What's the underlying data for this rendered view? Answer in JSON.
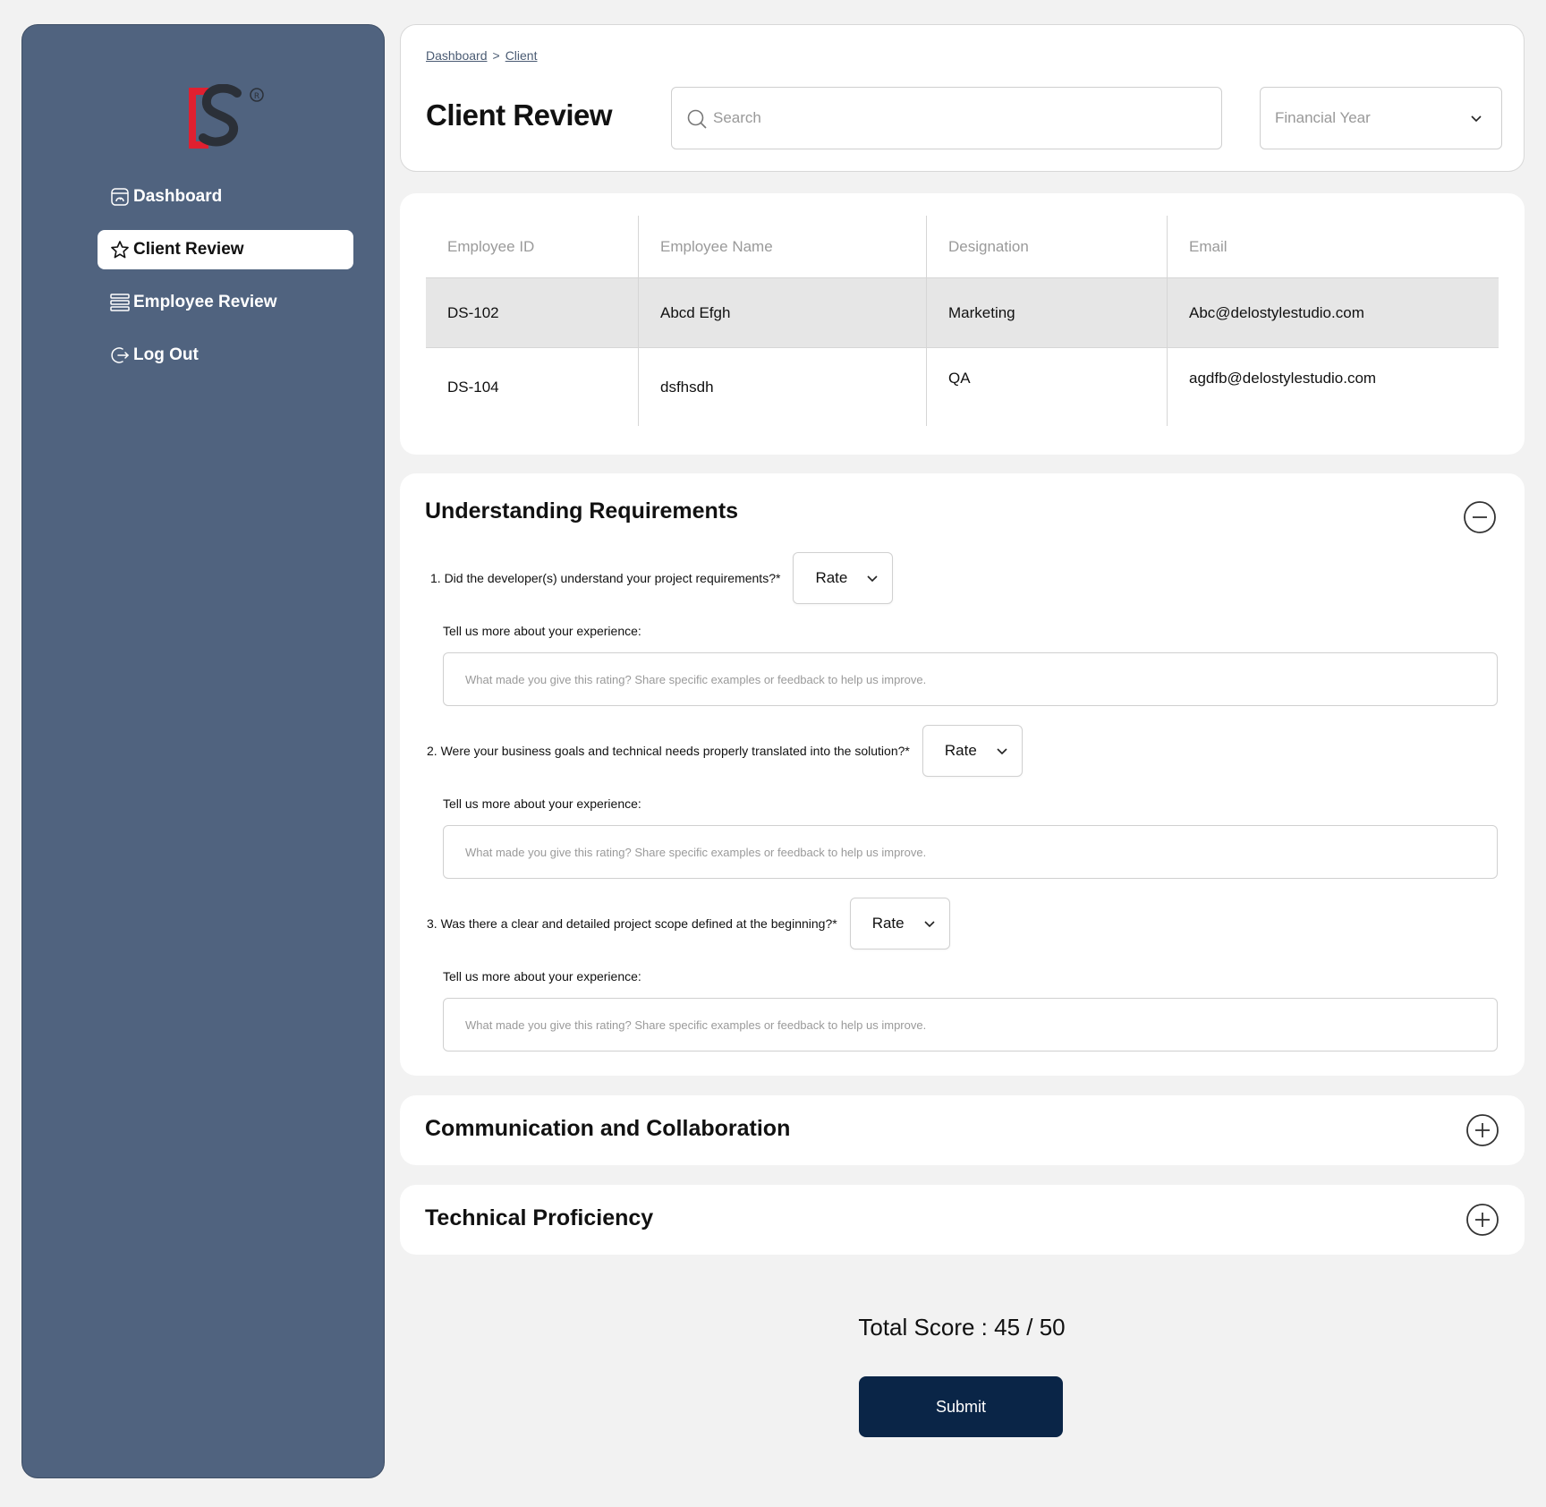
{
  "brand": {
    "logo_text": "DS",
    "registered_mark": "®",
    "accent_red": "#e02030",
    "dark": "#2b3038"
  },
  "sidebar": {
    "bg_color": "#50637f",
    "items": [
      {
        "label": "Dashboard",
        "icon": "dashboard-icon",
        "active": false
      },
      {
        "label": "Client Review",
        "icon": "star-icon",
        "active": true
      },
      {
        "label": "Employee Review",
        "icon": "list-icon",
        "active": false
      },
      {
        "label": "Log Out",
        "icon": "logout-icon",
        "active": false
      }
    ]
  },
  "header": {
    "breadcrumb": [
      "Dashboard",
      "Client"
    ],
    "breadcrumb_sep": ">",
    "title": "Client Review",
    "search_placeholder": "Search",
    "financial_year_placeholder": "Financial Year"
  },
  "table": {
    "columns": [
      "Employee ID",
      "Employee Name",
      "Designation",
      "Email"
    ],
    "rows": [
      [
        "DS-102",
        "Abcd Efgh",
        "Marketing",
        "Abc@delostylestudio.com"
      ],
      [
        "DS-104",
        "dsfhsdh",
        "QA",
        "agdfb@delostylestudio.com"
      ]
    ]
  },
  "sections": [
    {
      "title": "Understanding Requirements",
      "expanded": true,
      "questions": [
        {
          "text": "1. Did the developer(s) understand your project requirements?*",
          "rate_label": "Rate"
        },
        {
          "text": "2. Were your business goals and technical needs properly translated into the solution?*",
          "rate_label": "Rate"
        },
        {
          "text": "3. Was there a clear and detailed project scope defined at the beginning?*",
          "rate_label": "Rate"
        }
      ],
      "experience_label": "Tell us more about your experience:",
      "experience_placeholder": "What made you give this rating? Share specific examples or feedback to help us improve."
    },
    {
      "title": "Communication and Collaboration",
      "expanded": false
    },
    {
      "title": "Technical Proficiency",
      "expanded": false
    }
  ],
  "footer": {
    "total_score": "Total Score : 45 / 50",
    "submit_label": "Submit",
    "submit_color": "#0a2547"
  }
}
